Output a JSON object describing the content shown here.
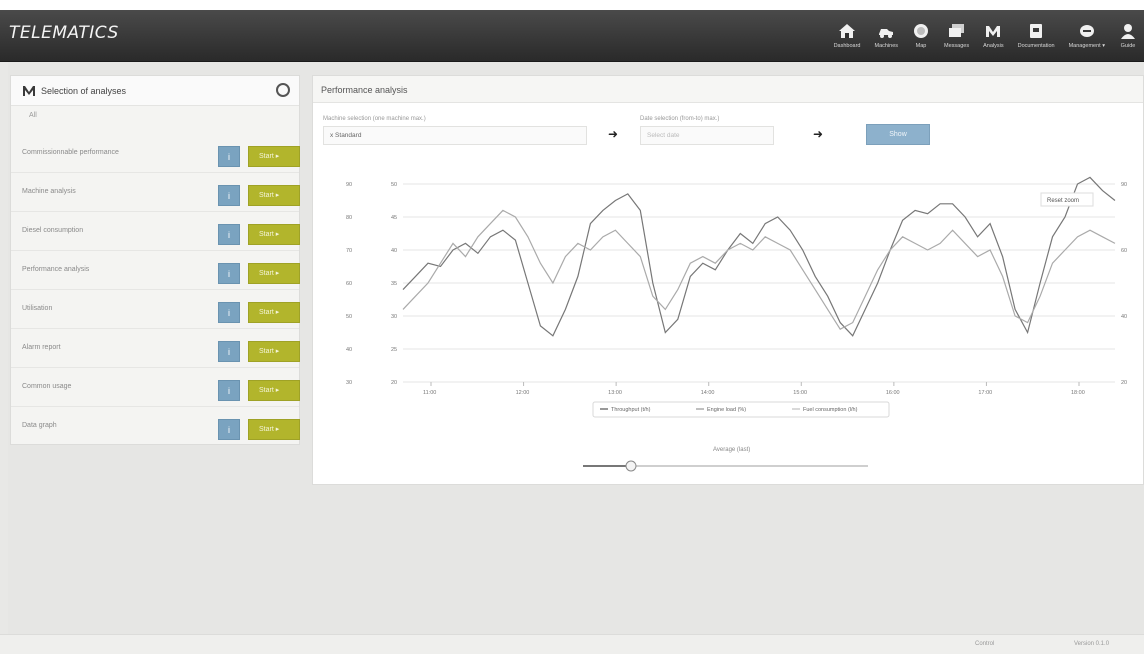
{
  "header": {
    "logo": "TELEMATICS",
    "nav": [
      {
        "label": "Dashboard",
        "icon": "home-icon"
      },
      {
        "label": "Machines",
        "icon": "machine-icon"
      },
      {
        "label": "Map",
        "icon": "globe-icon"
      },
      {
        "label": "Messages",
        "icon": "messages-icon"
      },
      {
        "label": "Analysis",
        "icon": "analysis-icon"
      },
      {
        "label": "Documentation",
        "icon": "document-icon"
      },
      {
        "label": "Management ▾",
        "icon": "management-icon"
      },
      {
        "label": "Guide",
        "icon": "user-icon"
      }
    ]
  },
  "left_panel": {
    "title": "Selection of analyses",
    "subtitle": "All",
    "analyses": [
      {
        "name": "Commissionnable performance",
        "info": "i",
        "start": "Start"
      },
      {
        "name": "Machine analysis",
        "info": "i",
        "start": "Start"
      },
      {
        "name": "Diesel consumption",
        "info": "i",
        "start": "Start"
      },
      {
        "name": "Performance analysis",
        "info": "i",
        "start": "Start"
      },
      {
        "name": "Utilisation",
        "info": "i",
        "start": "Start"
      },
      {
        "name": "Alarm report",
        "info": "i",
        "start": "Start"
      },
      {
        "name": "Common usage",
        "info": "i",
        "start": "Start"
      },
      {
        "name": "Data graph",
        "info": "i",
        "start": "Start"
      }
    ]
  },
  "right_panel": {
    "title": "Performance analysis",
    "machine_label": "Machine selection (one machine max.)",
    "machine_value": "x Standard",
    "date_label": "Date selection (from-to) max.)",
    "date_placeholder": "Select date",
    "show_button": "Show",
    "reset_zoom": "Reset zoom",
    "slider_label": "Average (last)"
  },
  "chart_data": {
    "type": "line",
    "x_ticks": [
      "11:00",
      "12:00",
      "13:00",
      "14:00",
      "15:00",
      "16:00",
      "17:00",
      "18:00"
    ],
    "left_axis_1": [
      "90",
      "80",
      "70",
      "60",
      "50",
      "40",
      "30"
    ],
    "left_axis_2": [
      "50",
      "45",
      "40",
      "35",
      "30",
      "25",
      "20"
    ],
    "right_axis": [
      "90",
      "",
      "60",
      "",
      "40",
      "",
      "20"
    ],
    "series": [
      {
        "name": "Throughput (t/h)",
        "color": "#777777",
        "values": [
          58,
          62,
          66,
          65,
          70,
          72,
          69,
          74,
          76,
          73,
          60,
          47,
          44,
          52,
          62,
          78,
          82,
          85,
          87,
          82,
          60,
          45,
          49,
          62,
          66,
          64,
          70,
          75,
          72,
          78,
          80,
          76,
          70,
          62,
          56,
          48,
          44,
          52,
          60,
          70,
          79,
          82,
          81,
          84,
          84,
          80,
          74,
          78,
          68,
          52,
          45,
          60,
          74,
          80,
          90,
          92,
          88,
          85
        ]
      },
      {
        "name": "Engine load (%)",
        "color": "#aaaaaa",
        "values": [
          52,
          56,
          60,
          66,
          72,
          68,
          74,
          78,
          82,
          80,
          74,
          66,
          60,
          68,
          72,
          70,
          74,
          76,
          72,
          68,
          56,
          52,
          58,
          66,
          68,
          66,
          70,
          72,
          70,
          74,
          72,
          70,
          64,
          58,
          52,
          46,
          48,
          56,
          64,
          70,
          74,
          72,
          70,
          72,
          76,
          72,
          68,
          70,
          62,
          50,
          48,
          56,
          66,
          70,
          74,
          76,
          74,
          72
        ]
      },
      {
        "name": "Fuel consumption (l/h)",
        "color": "#cccccc",
        "values": []
      }
    ]
  },
  "footer": {
    "left": "Control",
    "right": "Version 0.1.0"
  },
  "colors": {
    "header_bg": "#333333",
    "info_button": "#7aa3c0",
    "start_button": "#b2b52c",
    "show_button": "#8db1cc"
  }
}
